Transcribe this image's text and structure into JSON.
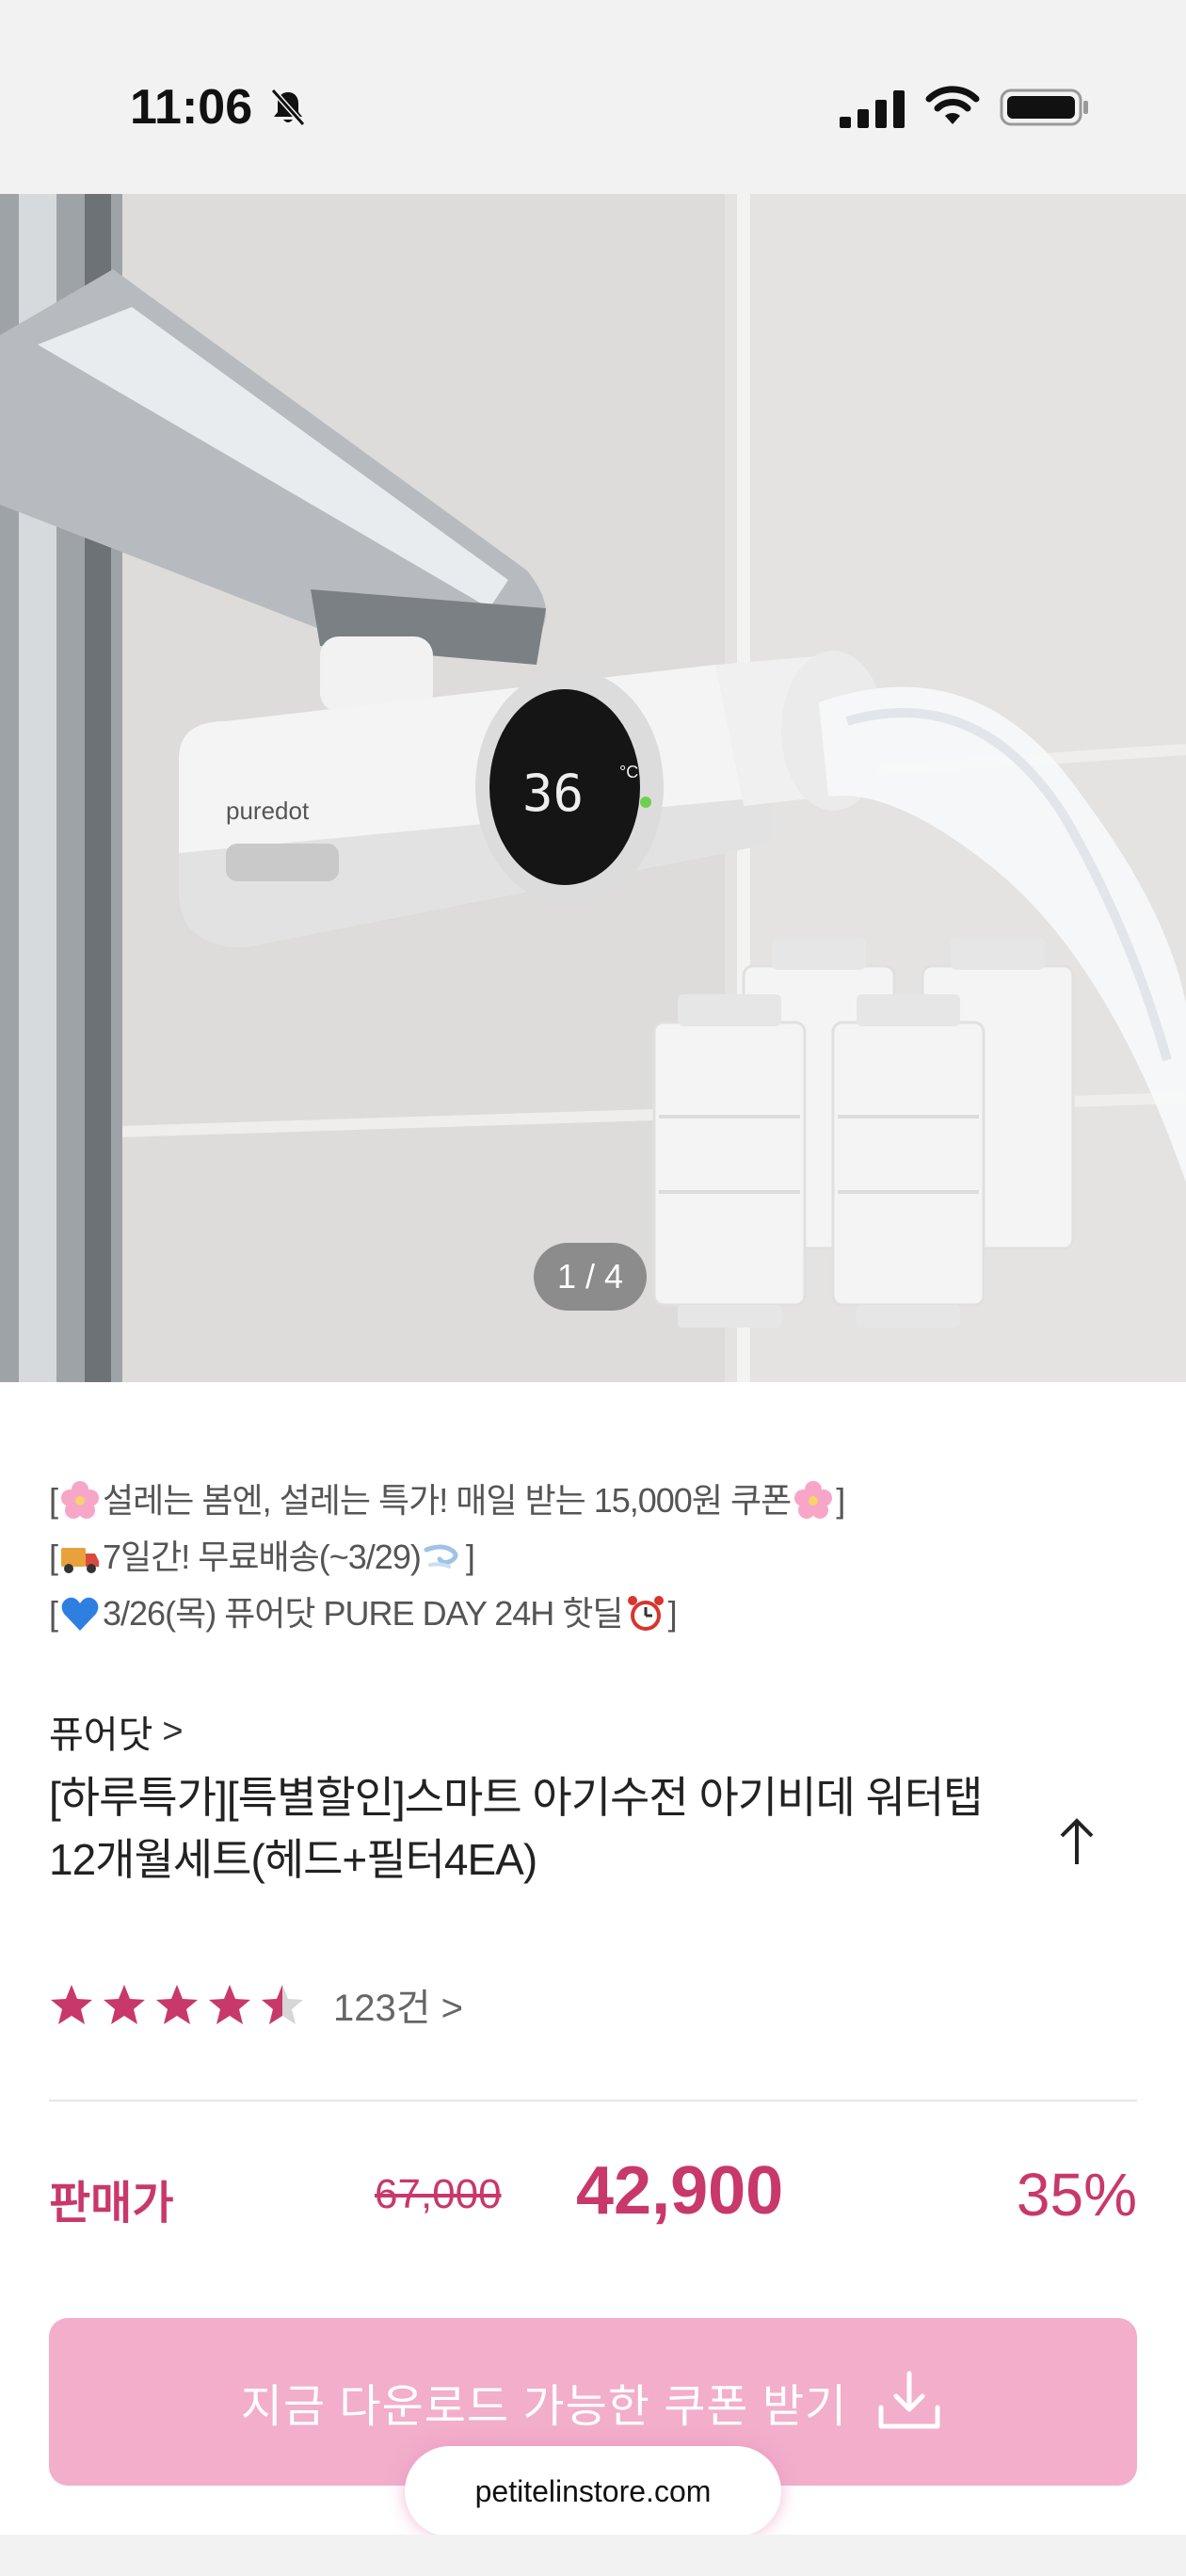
{
  "status_bar": {
    "time": "11:06",
    "icons": [
      "bell-slash-icon",
      "cellular-signal-icon",
      "wifi-icon",
      "battery-icon"
    ]
  },
  "hero": {
    "pager": "1 / 4",
    "brand_on_device": "puredot",
    "display_reading": "36",
    "display_unit": "°C"
  },
  "promo": {
    "line1": {
      "pre": "[",
      "emoji1": "cherry-blossom",
      "text": "설레는 봄엔, 설레는 특가! 매일 받는 15,000원 쿠폰",
      "emoji2": "cherry-blossom",
      "post": "]"
    },
    "line2": {
      "pre": "[",
      "emoji1": "delivery-truck",
      "text": "7일간! 무료배송(~3/29)",
      "emoji2": "dash",
      "post": "]"
    },
    "line3": {
      "pre": "[",
      "emoji1": "blue-heart",
      "text": "3/26(목) 퓨어닷 PURE DAY 24H 핫딜",
      "emoji2": "alarm-clock",
      "post": "]"
    }
  },
  "product": {
    "brand": "퓨어닷",
    "brand_chevron": ">",
    "title_line1": "[하루특가][특별할인]스마트 아기수전 아기비데 워터탭",
    "title_line2": "12개월세트(헤드+필터4EA)",
    "rating_value": 4.5,
    "review_count": "123건",
    "review_chevron": ">"
  },
  "price": {
    "label": "판매가",
    "original": "67,000",
    "sale": "42,900",
    "discount": "35%"
  },
  "coupon_button": {
    "label": "지금 다운로드 가능한 쿠폰 받기"
  },
  "url": "petitelinstore.com",
  "colors": {
    "accent": "#c8386b",
    "coupon_bg": "#f2aecb",
    "star": "#c8386b",
    "star_empty": "#d6d6d6"
  }
}
